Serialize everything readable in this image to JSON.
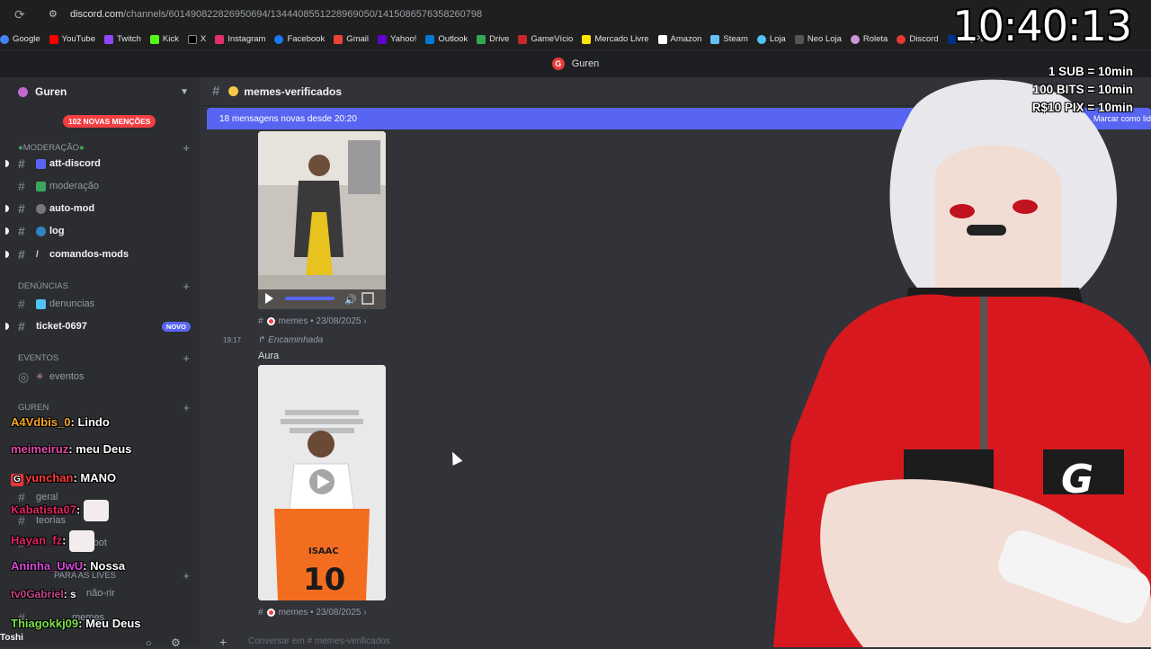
{
  "browser": {
    "url_host": "discord.com",
    "url_path": "/channels/601490822826950694/1344408551228969050/1415086576358260798",
    "bookmarks": [
      "Google",
      "YouTube",
      "Twitch",
      "Kick",
      "X",
      "Instagram",
      "Facebook",
      "Gmail",
      "Yahoo!",
      "Outlook",
      "Drive",
      "GameVício",
      "Mercado Livre",
      "Amazon",
      "Steam",
      "Loja",
      "Neo Loja",
      "Roleta",
      "Discord",
      "PayPal"
    ],
    "tab_title": "Guren"
  },
  "sidebar": {
    "server_name": "Guren",
    "mentions_pill": "102 NOVAS MENÇÕES",
    "categories": {
      "moderacao": "MODERAÇÃO",
      "denuncias": "DENÚNCIAS",
      "eventos": "EVENTOS",
      "guren": "GUREN",
      "para_as_lives": "PARA AS LIVES"
    },
    "channels": {
      "att_discord": "att-discord",
      "moderacao": "moderação",
      "auto_mod": "auto-mod",
      "log": "log",
      "comandos_mods": "comandos-mods",
      "denuncias": "denuncias",
      "ticket": "ticket-0697",
      "eventos": "eventos",
      "geral": "geral",
      "teorias": "teorias",
      "bot": "-bot",
      "nao_rir": "não-rir",
      "memes": "memes"
    },
    "new_badge": "NOVO",
    "current_user": "Toshi"
  },
  "main": {
    "channel_name": "memes-verificados",
    "new_messages_banner": "18 mensagens novas desde 20:20",
    "mark_read": "Marcar como lid",
    "messages": [
      {
        "meta_channel": "memes",
        "meta_date": "23/08/2025"
      },
      {
        "time": "19:17",
        "forwarded_label": "Encaminhada",
        "text": "Aura",
        "meta_channel": "memes",
        "meta_date": "23/08/2025"
      }
    ],
    "composer_placeholder": "Conversar em # memes-verificados"
  },
  "overlay": {
    "clock": "10:40:13",
    "promo": [
      "1 SUB = 10min",
      "100 BITS = 10min",
      "R$10 PIX = 10min"
    ],
    "chat": [
      {
        "user": "A4Vdbis_0",
        "message": "Lindo",
        "color": "#f5a623"
      },
      {
        "user": "meimeiruz",
        "message": "meu Deus",
        "color": "#e24aa8"
      },
      {
        "user": "yunchan",
        "message": "MANO",
        "color": "#ff3b3b"
      },
      {
        "user": "Kabatista07",
        "message": "",
        "color": "#e0245e"
      },
      {
        "user": "Hayan_fz",
        "message": "",
        "color": "#e0245e"
      },
      {
        "user": "Aninha_UwU",
        "message": "Nossa",
        "color": "#d44ad8"
      },
      {
        "user": "tv0Gabriel",
        "message": "s",
        "color": "#c4448a"
      },
      {
        "user": "Thiagokkj09",
        "message": "Meu Deus",
        "color": "#7ee04a"
      }
    ]
  }
}
